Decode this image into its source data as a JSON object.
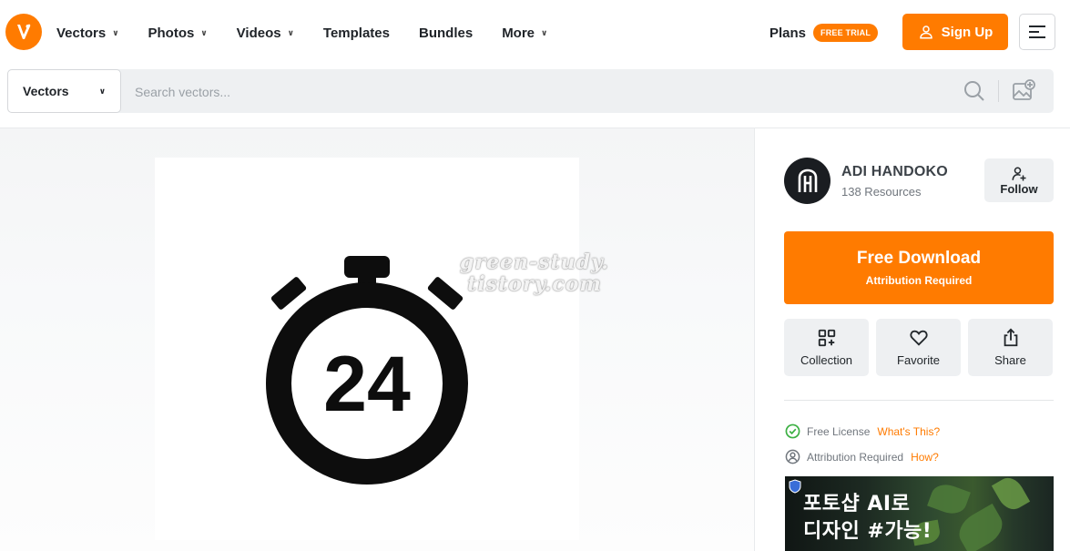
{
  "header": {
    "logo_icon": "vecteezy-logo-icon",
    "nav": [
      {
        "label": "Vectors",
        "has_dropdown": true
      },
      {
        "label": "Photos",
        "has_dropdown": true
      },
      {
        "label": "Videos",
        "has_dropdown": true
      },
      {
        "label": "Templates",
        "has_dropdown": false
      },
      {
        "label": "Bundles",
        "has_dropdown": false
      },
      {
        "label": "More",
        "has_dropdown": true
      }
    ],
    "plans_label": "Plans",
    "trial_badge": "FREE TRIAL",
    "signup_label": "Sign Up"
  },
  "search": {
    "scope_value": "Vectors",
    "placeholder": "Search vectors...",
    "value": ""
  },
  "preview": {
    "stopwatch_number": "24",
    "watermark_line1": "green-study.",
    "watermark_line2": "tistory.com"
  },
  "sidebar": {
    "author_name": "ADI HANDOKO",
    "author_resources": "138 Resources",
    "follow_label": "Follow",
    "download_title": "Free Download",
    "download_sub": "Attribution Required",
    "actions": [
      {
        "label": "Collection",
        "icon": "collection-add-icon"
      },
      {
        "label": "Favorite",
        "icon": "heart-icon"
      },
      {
        "label": "Share",
        "icon": "share-icon"
      }
    ],
    "license": [
      {
        "text": "Free License",
        "link": "What's This?",
        "icon": "check-circle-icon"
      },
      {
        "text": "Attribution Required",
        "link": "How?",
        "icon": "user-circle-icon"
      }
    ],
    "ad": {
      "line1": "포토샵 AI로",
      "line2": "디자인 #가능!"
    }
  },
  "colors": {
    "accent": "#ff7b00",
    "surface": "#eef0f2",
    "text": "#22272b",
    "muted": "#70767d",
    "success": "#3cb043"
  }
}
